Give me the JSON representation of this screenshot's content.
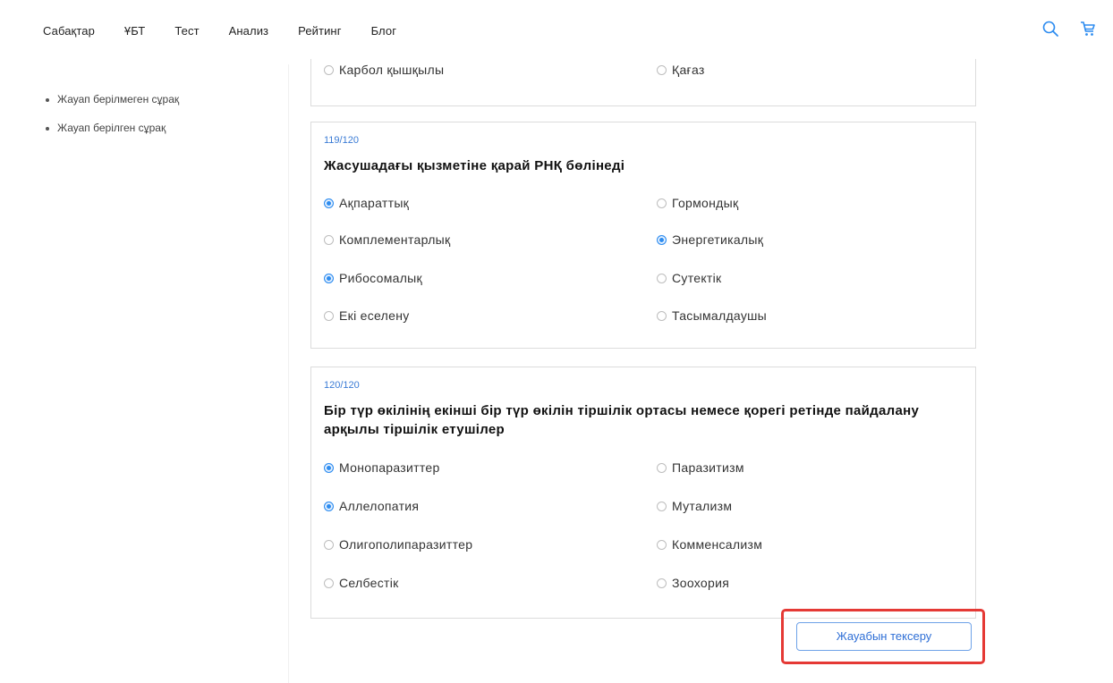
{
  "nav": [
    "Сабақтар",
    "ҰБТ",
    "Тест",
    "Анализ",
    "Рейтинг",
    "Блог"
  ],
  "icons": {
    "search": "search-icon",
    "cart": "cart-icon"
  },
  "colors": {
    "accent": "#2d8cf0",
    "highlight": "#e53935",
    "qnum": "#3a7bd5"
  },
  "legend": [
    "Жауап берілмеген сұрақ",
    "Жауап берілген сұрақ"
  ],
  "prev_question": {
    "options": [
      {
        "label": "Карбол қышқылы",
        "selected": false
      },
      {
        "label": "Қағаз",
        "selected": false
      }
    ]
  },
  "questions": [
    {
      "number": "119/120",
      "text": "Жасушадағы қызметіне қарай РНҚ бөлінеді",
      "options": [
        {
          "label": "Ақпараттық",
          "selected": true
        },
        {
          "label": "Гормондық",
          "selected": false
        },
        {
          "label": "Комплементарлық",
          "selected": false
        },
        {
          "label": "Энергетикалық",
          "selected": true
        },
        {
          "label": "Рибосомалық",
          "selected": true
        },
        {
          "label": "Сутектік",
          "selected": false
        },
        {
          "label": "Екі еселену",
          "selected": false
        },
        {
          "label": "Тасымалдаушы",
          "selected": false
        }
      ]
    },
    {
      "number": "120/120",
      "text": "Бір түр өкілінің екінші бір түр өкілін тіршілік ортасы немесе қорегі ретінде пайдалану арқылы тіршілік етушілер",
      "options": [
        {
          "label": "Монопаразиттер",
          "selected": true
        },
        {
          "label": "Паразитизм",
          "selected": false
        },
        {
          "label": "Аллелопатия",
          "selected": true
        },
        {
          "label": "Мутализм",
          "selected": false
        },
        {
          "label": "Олигополипаразиттер",
          "selected": false
        },
        {
          "label": "Комменсализм",
          "selected": false
        },
        {
          "label": "Селбестік",
          "selected": false
        },
        {
          "label": "Зоохория",
          "selected": false
        }
      ]
    }
  ],
  "check_button": "Жауабын тексеру"
}
